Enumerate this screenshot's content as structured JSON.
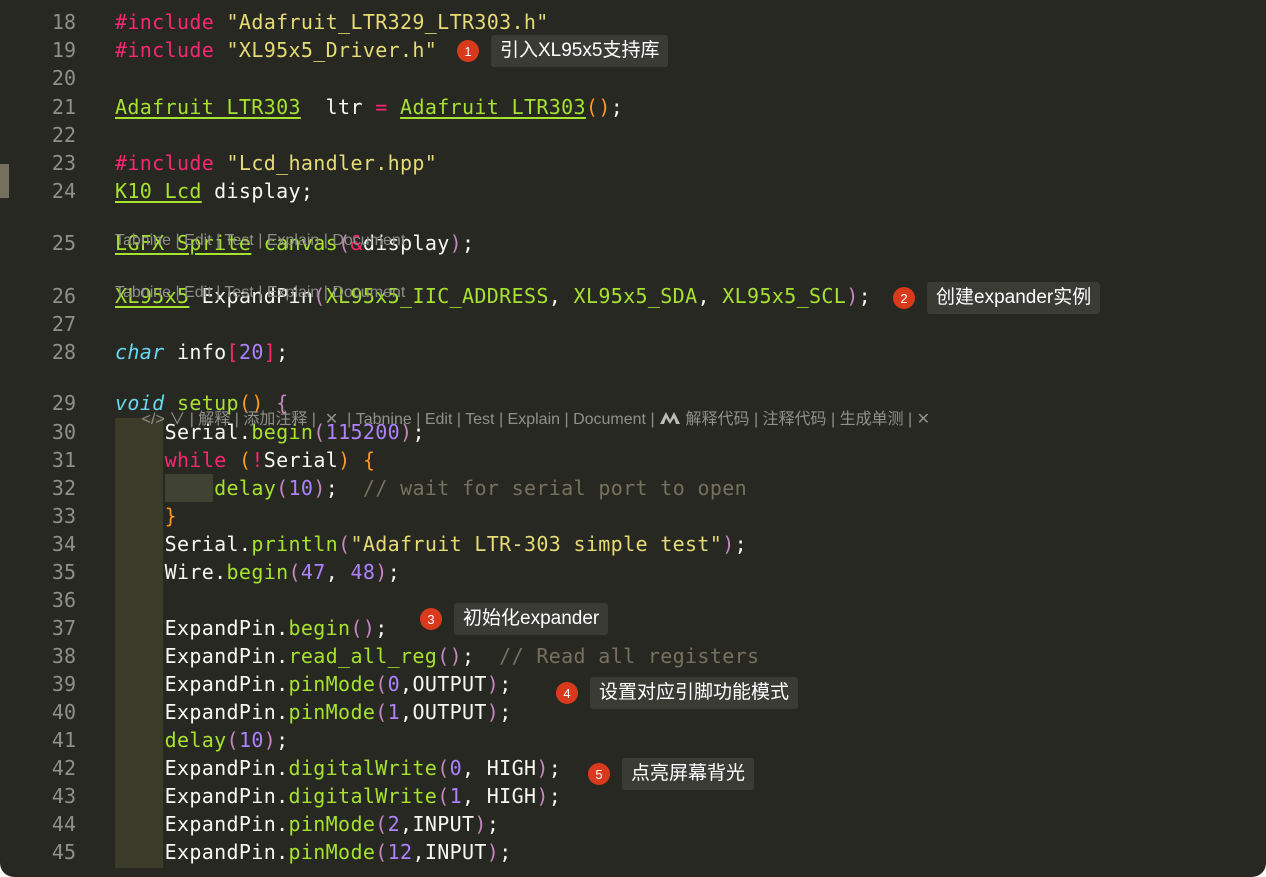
{
  "lines": [
    {
      "n": "18",
      "segs": [
        [
          "kw",
          "#include "
        ],
        [
          "str",
          "\"Adafruit_LTR329_LTR303.h\""
        ]
      ]
    },
    {
      "n": "19",
      "segs": [
        [
          "kw",
          "#include "
        ],
        [
          "str",
          "\"XL95x5_Driver.h\""
        ]
      ]
    },
    {
      "n": "20",
      "segs": []
    },
    {
      "n": "21",
      "segs": [
        [
          "ty",
          "Adafruit_LTR303"
        ],
        [
          "",
          "  ltr "
        ],
        [
          "kw",
          "="
        ],
        [
          "",
          " "
        ],
        [
          "ty",
          "Adafruit_LTR303"
        ],
        [
          "p3",
          "()"
        ],
        [
          "",
          ";"
        ]
      ]
    },
    {
      "n": "22",
      "segs": []
    },
    {
      "n": "23",
      "segs": [
        [
          "kw",
          "#include "
        ],
        [
          "str",
          "\"Lcd_handler.hpp\""
        ]
      ]
    },
    {
      "n": "24",
      "segs": [
        [
          "ty",
          "K10_Lcd"
        ],
        [
          "",
          " display;"
        ]
      ]
    },
    {
      "n": "25",
      "segs": [
        [
          "ty",
          "LGFX_Sprite"
        ],
        [
          "",
          " "
        ],
        [
          "fn",
          "canvas"
        ],
        [
          "p2",
          "("
        ],
        [
          "kw",
          "&"
        ],
        [
          "",
          "display"
        ],
        [
          "p2",
          ")"
        ],
        [
          "",
          ";"
        ]
      ]
    },
    {
      "n": "26",
      "segs": [
        [
          "ty",
          "XL95x5"
        ],
        [
          "",
          " "
        ],
        [
          "",
          "ExpandPin"
        ],
        [
          "p2",
          "("
        ],
        [
          "fn",
          "XL95x5_IIC_ADDRESS"
        ],
        [
          "",
          ", "
        ],
        [
          "fn",
          "XL95x5_SDA"
        ],
        [
          "",
          ", "
        ],
        [
          "fn",
          "XL95x5_SCL"
        ],
        [
          "p2",
          ")"
        ],
        [
          "",
          ";"
        ]
      ]
    },
    {
      "n": "27",
      "segs": []
    },
    {
      "n": "28",
      "segs": [
        [
          "it",
          "char"
        ],
        [
          "",
          " info"
        ],
        [
          "p1",
          "["
        ],
        [
          "num",
          "20"
        ],
        [
          "p1",
          "]"
        ],
        [
          "",
          ";"
        ]
      ]
    },
    {
      "n": "29",
      "segs": [
        [
          "it",
          "void"
        ],
        [
          "",
          " "
        ],
        [
          "fn",
          "setup"
        ],
        [
          "p3",
          "()"
        ],
        [
          "",
          " "
        ],
        [
          "p2",
          "{"
        ]
      ]
    },
    {
      "n": "30",
      "segs": [
        [
          "",
          "    Serial."
        ],
        [
          "fn",
          "begin"
        ],
        [
          "p2",
          "("
        ],
        [
          "num",
          "115200"
        ],
        [
          "p2",
          ")"
        ],
        [
          "",
          ";"
        ]
      ]
    },
    {
      "n": "31",
      "segs": [
        [
          "",
          "    "
        ],
        [
          "kw",
          "while"
        ],
        [
          "",
          " "
        ],
        [
          "p3",
          "("
        ],
        [
          "kw",
          "!"
        ],
        [
          "",
          "Serial"
        ],
        [
          "p3",
          ")"
        ],
        [
          "",
          " "
        ],
        [
          "p3",
          "{"
        ]
      ]
    },
    {
      "n": "32",
      "segs": [
        [
          "",
          "        "
        ],
        [
          "fn",
          "delay"
        ],
        [
          "p2",
          "("
        ],
        [
          "num",
          "10"
        ],
        [
          "p2",
          ")"
        ],
        [
          ";",
          ";"
        ],
        [
          "",
          "  "
        ],
        [
          "cm",
          "// wait for serial port to open"
        ]
      ]
    },
    {
      "n": "33",
      "segs": [
        [
          "",
          "    "
        ],
        [
          "p3",
          "}"
        ]
      ]
    },
    {
      "n": "34",
      "segs": [
        [
          "",
          "    Serial."
        ],
        [
          "fn",
          "println"
        ],
        [
          "p2",
          "("
        ],
        [
          "str",
          "\"Adafruit LTR-303 simple test\""
        ],
        [
          "p2",
          ")"
        ],
        [
          "",
          ";"
        ]
      ]
    },
    {
      "n": "35",
      "segs": [
        [
          "",
          "    Wire."
        ],
        [
          "fn",
          "begin"
        ],
        [
          "p2",
          "("
        ],
        [
          "num",
          "47"
        ],
        [
          "",
          ", "
        ],
        [
          "num",
          "48"
        ],
        [
          "p2",
          ")"
        ],
        [
          "",
          ";"
        ]
      ]
    },
    {
      "n": "36",
      "segs": []
    },
    {
      "n": "37",
      "segs": [
        [
          "",
          "    ExpandPin."
        ],
        [
          "fn",
          "begin"
        ],
        [
          "p2",
          "()"
        ],
        [
          "",
          ";"
        ]
      ]
    },
    {
      "n": "38",
      "segs": [
        [
          "",
          "    ExpandPin."
        ],
        [
          "fn",
          "read_all_reg"
        ],
        [
          "p2",
          "()"
        ],
        [
          "",
          ";  "
        ],
        [
          "cm",
          "// Read all registers"
        ]
      ]
    },
    {
      "n": "39",
      "segs": [
        [
          "",
          "    ExpandPin."
        ],
        [
          "fn",
          "pinMode"
        ],
        [
          "p2",
          "("
        ],
        [
          "num",
          "0"
        ],
        [
          "",
          ",OUTPUT"
        ],
        [
          "p2",
          ")"
        ],
        [
          "",
          ";"
        ]
      ]
    },
    {
      "n": "40",
      "segs": [
        [
          "",
          "    ExpandPin."
        ],
        [
          "fn",
          "pinMode"
        ],
        [
          "p2",
          "("
        ],
        [
          "num",
          "1"
        ],
        [
          "",
          ",OUTPUT"
        ],
        [
          "p2",
          ")"
        ],
        [
          "",
          ";"
        ]
      ]
    },
    {
      "n": "41",
      "segs": [
        [
          "",
          "    "
        ],
        [
          "fn",
          "delay"
        ],
        [
          "p2",
          "("
        ],
        [
          "num",
          "10"
        ],
        [
          "p2",
          ")"
        ],
        [
          "",
          ";"
        ]
      ]
    },
    {
      "n": "42",
      "segs": [
        [
          "",
          "    ExpandPin."
        ],
        [
          "fn",
          "digitalWrite"
        ],
        [
          "p2",
          "("
        ],
        [
          "num",
          "0"
        ],
        [
          "",
          ", HIGH"
        ],
        [
          "p2",
          ")"
        ],
        [
          "",
          ";"
        ]
      ]
    },
    {
      "n": "43",
      "segs": [
        [
          "",
          "    ExpandPin."
        ],
        [
          "fn",
          "digitalWrite"
        ],
        [
          "p2",
          "("
        ],
        [
          "num",
          "1"
        ],
        [
          "",
          ", HIGH"
        ],
        [
          "p2",
          ")"
        ],
        [
          "",
          ";"
        ]
      ]
    },
    {
      "n": "44",
      "segs": [
        [
          "",
          "    ExpandPin."
        ],
        [
          "fn",
          "pinMode"
        ],
        [
          "p2",
          "("
        ],
        [
          "num",
          "2"
        ],
        [
          "",
          ",INPUT"
        ],
        [
          "p2",
          ")"
        ],
        [
          "",
          ";"
        ]
      ]
    },
    {
      "n": "45",
      "segs": [
        [
          "",
          "    ExpandPin."
        ],
        [
          "fn",
          "pinMode"
        ],
        [
          "p2",
          "("
        ],
        [
          "num",
          "12"
        ],
        [
          "",
          ",INPUT"
        ],
        [
          "p2",
          ")"
        ],
        [
          "",
          ";"
        ]
      ]
    }
  ],
  "codelens": {
    "tabnine_1": "Tabnine | Edit | Test | Explain | Document",
    "tabnine_2": "Tabnine | Edit | Test | Explain | Document",
    "setup_lens_prefix": "</> ∨ | 解释 | 添加注释 |  ✕  | Tabnine | Edit | Test | Explain | Document | ",
    "setup_lens_suffix": " 解释代码 | 注释代码 | 生成单测 | ✕"
  },
  "annotations": [
    {
      "num": "1",
      "text": "引入XL95x5支持库"
    },
    {
      "num": "2",
      "text": "创建expander实例"
    },
    {
      "num": "3",
      "text": "初始化expander"
    },
    {
      "num": "4",
      "text": "设置对应引脚功能模式"
    },
    {
      "num": "5",
      "text": "点亮屏幕背光"
    }
  ],
  "colors": {
    "background": "#272822",
    "keyword": "#f92672",
    "string": "#e6db74",
    "function": "#a6e22e",
    "number": "#ae81ff",
    "type_italic": "#66d9ef",
    "comment": "#75715e",
    "badge": "#d93a1c"
  }
}
